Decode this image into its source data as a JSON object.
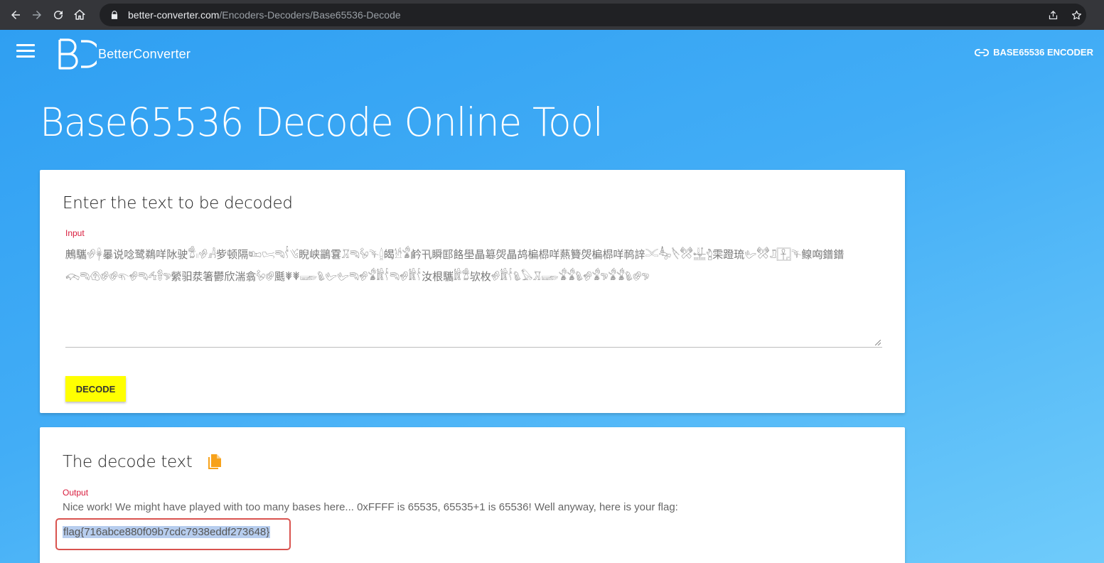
{
  "browser": {
    "url_host": "better-converter.com",
    "url_path": "/Encoders-Decoders/Base65536-Decode"
  },
  "nav": {
    "brand": "BetterConverter",
    "link_label": "BASE65536 ENCODER"
  },
  "hero": {
    "title": "Base65536 Decode Online Tool"
  },
  "input_card": {
    "title": "Enter the text to be decoded",
    "label": "Input",
    "value": "鶊驨𔐅𓋈曓说唸鹭鵜咩阥驶𔐁𓏻𔐅𓀻㱔顿隔𔐨𔐪𔑔𔐔𔐥睨峡鶅䨢𔑙𔑔𔐢𔑖𓐬㿣𓀳𔐃鹶卂瞬邼餎壆瞐簒焈瞐鸪楄㭿咩爇籫焈楄㭿咩䴓䛨𓄌𔐳𓌸𔐠𓈭𔑇雬蹬琉𔐦𔐠𔑛𓉢𔑖鳈㕼鐠鐠𔐫𔑔𔐊𔐀𔐀𔐬𔐆𔑔𔐛𔐌𔑕縈驲汬箸鬱欣湍翕𔐢𔐀䫽𐘃𐘃𓆃𔑗𔐦𔐦𔑔𔐆𔐃𔐂𔐔𔑔𔐆𔐂𔐔汝根驨𔐂𔐁欤枚𔐇𔐂𔐔𔑗𓅃𔑙𓆃𔐃𔐃𔑗𔐆𔐃𔑕𔐃𔐃𔑗𔐀𔑕",
    "decode_label": "DECODE"
  },
  "output_card": {
    "title": "The decode text",
    "label": "Output",
    "text": "Nice work! We might have played with too many bases here... 0xFFFF is 65535, 65535+1 is 65536! Well anyway, here is your flag:",
    "flag": "flag{716abce880f09b7cdc7938eddf273648}"
  },
  "colors": {
    "page_gradient_start": "#2f9ff2",
    "page_gradient_end": "#6fcbfa",
    "decode_button": "#ffff00",
    "label_red": "#d81b3c",
    "copy_icon": "#f7a21b",
    "highlight_box": "#d9534f"
  },
  "icons": [
    "back-icon",
    "forward-icon",
    "reload-icon",
    "home-icon",
    "lock-icon",
    "share-icon",
    "star-icon",
    "menu-icon",
    "link-icon",
    "copy-icon"
  ]
}
